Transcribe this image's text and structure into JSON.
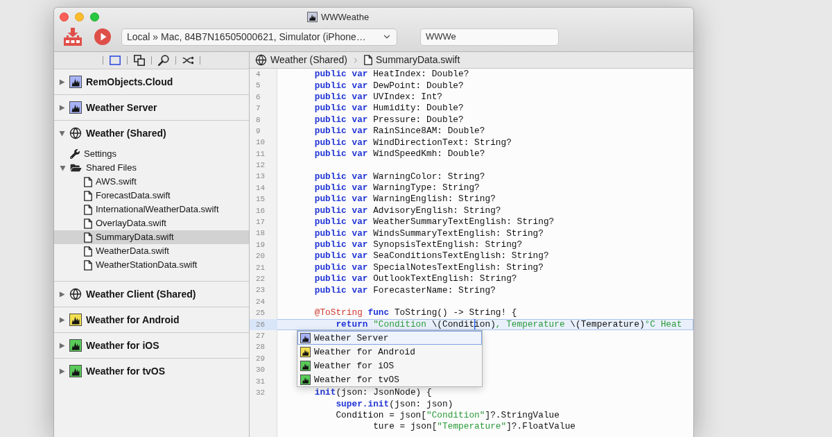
{
  "window": {
    "title": "WWWeathe"
  },
  "toolbar": {
    "destination": "Local » Mac, 84B7N16505000621, Simulator (iPhone…",
    "status": "WWWe"
  },
  "sidebar": {
    "tabs": [
      {
        "selected": true
      },
      {
        "selected": false
      },
      {
        "selected": false
      },
      {
        "selected": false
      }
    ],
    "tree": [
      {
        "label": "RemObjects.Cloud",
        "kind": "project",
        "color": "#a7b3f5",
        "expanded": false,
        "selected": false
      },
      {
        "label": "Weather Server",
        "kind": "project",
        "color": "#a7b3f5",
        "expanded": false,
        "selected": false
      },
      {
        "label": "Weather (Shared)",
        "kind": "shared",
        "expanded": true,
        "selected": false,
        "children": [
          {
            "label": "Settings",
            "kind": "settings",
            "selected": false
          },
          {
            "label": "Shared Files",
            "kind": "folder",
            "expanded": true,
            "selected": false,
            "children": [
              {
                "label": "AWS.swift",
                "kind": "file",
                "selected": false
              },
              {
                "label": "ForecastData.swift",
                "kind": "file",
                "selected": false
              },
              {
                "label": "InternationalWeatherData.swift",
                "kind": "file",
                "selected": false
              },
              {
                "label": "OverlayData.swift",
                "kind": "file",
                "selected": false
              },
              {
                "label": "SummaryData.swift",
                "kind": "file",
                "selected": true
              },
              {
                "label": "WeatherData.swift",
                "kind": "file",
                "selected": false
              },
              {
                "label": "WeatherStationData.swift",
                "kind": "file",
                "selected": false
              }
            ]
          }
        ]
      },
      {
        "label": "Weather Client (Shared)",
        "kind": "shared",
        "expanded": false,
        "selected": false
      },
      {
        "label": "Weather for Android",
        "kind": "project",
        "color": "#f3df4f",
        "expanded": false,
        "selected": false
      },
      {
        "label": "Weather for iOS",
        "kind": "project",
        "color": "#5acb5a",
        "expanded": false,
        "selected": false
      },
      {
        "label": "Weather for tvOS",
        "kind": "project",
        "color": "#5acb5a",
        "expanded": false,
        "selected": false
      }
    ]
  },
  "editor": {
    "breadcrumb": [
      {
        "label": "Weather (Shared)",
        "kind": "shared"
      },
      {
        "label": "SummaryData.swift",
        "kind": "file"
      }
    ],
    "lines": [
      {
        "number": "4",
        "highlighted": false,
        "tokens": [
          {
            "kind": "keyword",
            "text": "    public var"
          },
          {
            "kind": "plain",
            "text": " HeatIndex: Double?"
          }
        ]
      },
      {
        "number": "5",
        "highlighted": false,
        "tokens": [
          {
            "kind": "keyword",
            "text": "    public var"
          },
          {
            "kind": "plain",
            "text": " DewPoint: Double?"
          }
        ]
      },
      {
        "number": "6",
        "highlighted": false,
        "tokens": [
          {
            "kind": "keyword",
            "text": "    public var"
          },
          {
            "kind": "plain",
            "text": " UVIndex: Int?"
          }
        ]
      },
      {
        "number": "7",
        "highlighted": false,
        "tokens": [
          {
            "kind": "keyword",
            "text": "    public var"
          },
          {
            "kind": "plain",
            "text": " Humidity: Double?"
          }
        ]
      },
      {
        "number": "8",
        "highlighted": false,
        "tokens": [
          {
            "kind": "keyword",
            "text": "    public var"
          },
          {
            "kind": "plain",
            "text": " Pressure: Double?"
          }
        ]
      },
      {
        "number": "9",
        "highlighted": false,
        "tokens": [
          {
            "kind": "keyword",
            "text": "    public var"
          },
          {
            "kind": "plain",
            "text": " RainSince8AM: Double?"
          }
        ]
      },
      {
        "number": "10",
        "highlighted": false,
        "tokens": [
          {
            "kind": "keyword",
            "text": "    public var"
          },
          {
            "kind": "plain",
            "text": " WindDirectionText: String?"
          }
        ]
      },
      {
        "number": "11",
        "highlighted": false,
        "tokens": [
          {
            "kind": "keyword",
            "text": "    public var"
          },
          {
            "kind": "plain",
            "text": " WindSpeedKmh: Double?"
          }
        ]
      },
      {
        "number": "12",
        "highlighted": false
      },
      {
        "number": "13",
        "highlighted": false,
        "tokens": [
          {
            "kind": "keyword",
            "text": "    public var"
          },
          {
            "kind": "plain",
            "text": " WarningColor: String?"
          }
        ]
      },
      {
        "number": "14",
        "highlighted": false,
        "tokens": [
          {
            "kind": "keyword",
            "text": "    public var"
          },
          {
            "kind": "plain",
            "text": " WarningType: String?"
          }
        ]
      },
      {
        "number": "15",
        "highlighted": false,
        "tokens": [
          {
            "kind": "keyword",
            "text": "    public var"
          },
          {
            "kind": "plain",
            "text": " WarningEnglish: String?"
          }
        ]
      },
      {
        "number": "16",
        "highlighted": false,
        "tokens": [
          {
            "kind": "keyword",
            "text": "    public var"
          },
          {
            "kind": "plain",
            "text": " AdvisoryEnglish: String?"
          }
        ]
      },
      {
        "number": "17",
        "highlighted": false,
        "tokens": [
          {
            "kind": "keyword",
            "text": "    public var"
          },
          {
            "kind": "plain",
            "text": " WeatherSummaryTextEnglish: String?"
          }
        ]
      },
      {
        "number": "18",
        "highlighted": false,
        "tokens": [
          {
            "kind": "keyword",
            "text": "    public var"
          },
          {
            "kind": "plain",
            "text": " WindsSummaryTextEnglish: String?"
          }
        ]
      },
      {
        "number": "19",
        "highlighted": false,
        "tokens": [
          {
            "kind": "keyword",
            "text": "    public var"
          },
          {
            "kind": "plain",
            "text": " SynopsisTextEnglish: String?"
          }
        ]
      },
      {
        "number": "20",
        "highlighted": false,
        "tokens": [
          {
            "kind": "keyword",
            "text": "    public var"
          },
          {
            "kind": "plain",
            "text": " SeaConditionsTextEnglish: String?"
          }
        ]
      },
      {
        "number": "21",
        "highlighted": false,
        "tokens": [
          {
            "kind": "keyword",
            "text": "    public var"
          },
          {
            "kind": "plain",
            "text": " SpecialNotesTextEnglish: String?"
          }
        ]
      },
      {
        "number": "22",
        "highlighted": false,
        "tokens": [
          {
            "kind": "keyword",
            "text": "    public var"
          },
          {
            "kind": "plain",
            "text": " OutlookTextEnglish: String?"
          }
        ]
      },
      {
        "number": "23",
        "highlighted": false,
        "tokens": [
          {
            "kind": "keyword",
            "text": "    public var"
          },
          {
            "kind": "plain",
            "text": " ForecasterName: String?"
          }
        ]
      },
      {
        "number": "24",
        "highlighted": false
      },
      {
        "number": "25",
        "highlighted": false,
        "tokens": [
          {
            "kind": "attribute",
            "text": "    @ToString"
          },
          {
            "kind": "keyword",
            "text": " func"
          },
          {
            "kind": "plain",
            "text": " ToString() -> String! {"
          }
        ]
      },
      {
        "number": "26",
        "highlighted": true,
        "tokens": [
          {
            "kind": "keyword",
            "text": "        return"
          },
          {
            "kind": "string",
            "text": " \"Condition "
          },
          {
            "kind": "plain",
            "text": "\\(Condit"
          },
          {
            "kind": "caret"
          },
          {
            "kind": "plain",
            "text": "ion)"
          },
          {
            "kind": "string",
            "text": ", Temperature "
          },
          {
            "kind": "plain",
            "text": "\\(Temperature)"
          },
          {
            "kind": "string",
            "text": "°C Heat"
          }
        ]
      },
      {
        "number": "27",
        "highlighted": false
      },
      {
        "number": "28",
        "highlighted": false
      },
      {
        "number": "29",
        "highlighted": false
      },
      {
        "number": "30",
        "highlighted": false
      },
      {
        "number": "31",
        "highlighted": false
      },
      {
        "number": "32",
        "highlighted": false,
        "tokens": [
          {
            "kind": "keyword",
            "text": "    init"
          },
          {
            "kind": "plain",
            "text": "(json: JsonNode) {"
          }
        ]
      },
      {
        "highlighted": false,
        "tokens": [
          {
            "kind": "keyword",
            "text": "        super.init"
          },
          {
            "kind": "plain",
            "text": "(json: json)"
          }
        ]
      },
      {
        "highlighted": false,
        "tokens": [
          {
            "kind": "plain",
            "text": "        Condition = json["
          },
          {
            "kind": "string",
            "text": "\"Condition\""
          },
          {
            "kind": "plain",
            "text": "]?.StringValue"
          }
        ]
      },
      {
        "highlighted": false,
        "tokens": [
          {
            "kind": "plain",
            "text": "               ture = json["
          },
          {
            "kind": "string",
            "text": "\"Temperature\""
          },
          {
            "kind": "plain",
            "text": "]?.FloatValue"
          }
        ]
      }
    ]
  },
  "completion": {
    "items": [
      {
        "label": "Weather Server",
        "color": "#a7b3f5",
        "selected": true
      },
      {
        "label": "Weather for Android",
        "color": "#f3df4f",
        "selected": false
      },
      {
        "label": "Weather for iOS",
        "color": "#5acb5a",
        "selected": false
      },
      {
        "label": "Weather for tvOS",
        "color": "#5acb5a",
        "selected": false
      }
    ]
  }
}
